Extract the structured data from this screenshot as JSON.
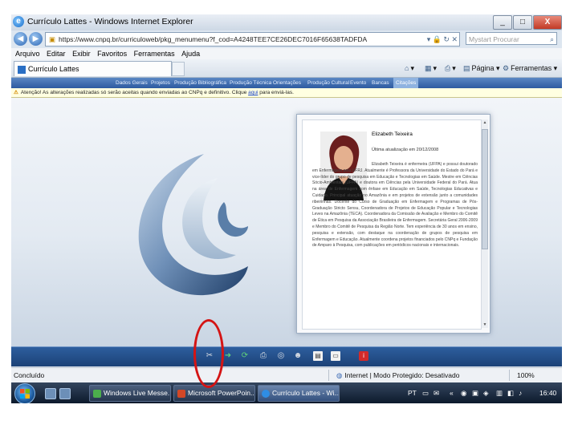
{
  "window": {
    "title": "Currículo Lattes - Windows Internet Explorer",
    "controls": [
      "_",
      "□",
      "X"
    ]
  },
  "address": {
    "url": "https://www.cnpq.br/curriculoweb/pkg_menumenu?f_cod=A4248TEE7CE26DEC7016F65638TADFDA",
    "search_placeholder": "Mystart Procurar"
  },
  "menu": [
    "Arquivo",
    "Editar",
    "Exibir",
    "Favoritos",
    "Ferramentas",
    "Ajuda"
  ],
  "tab": {
    "label": "Currículo Lattes",
    "page_label": "Página",
    "tools_label": "Ferramentas"
  },
  "site_nav": {
    "items": [
      "Dados Gerais",
      "Projetos",
      "Produção Bibliográfica",
      "Produção Técnica",
      "Orientações",
      "Produção Cultural",
      "Evento",
      "Bancas",
      "Citações"
    ],
    "active": "Citações"
  },
  "warning": {
    "text": "Atenção! As alterações realizadas só serão aceitas quando enviadas ao CNPq e definitivo. Clique",
    "link": "aqui",
    "suffix": "para enviá-las."
  },
  "profile": {
    "name": "Elizabeth Teixeira",
    "updated": "Última atualização em 20/12/2008",
    "bio": "Elizabeth Teixeira é enfermeira (UFPA) e possui doutorado em Enfermagem pela UFRJ. Atualmente é Professora da Universidade do Estado do Pará e vice-líder do grupo de pesquisa em Educação e Tecnologias em Saúde. Mestre em Ciências Sócio-Ambientais (UFPA) e doutora em Ciências pela Universidade Federal do Pará. Atua na área de Enfermagem com ênfase em Educação em Saúde, Tecnologias Educativas e Cuidado. Principal atuação no Amazônia e em projetos de extensão junto a comunidades ribeirinhas. Docente do Curso de Graduação em Enfermagem e Programas de Pós-Graduação Stricto Sensu, Coordenadora de Projetos de Educação Popular e Tecnologias Leves na Amazônia (TECA). Coordenadora da Comissão de Avaliação e Membro do Comitê de Ética em Pesquisa da Associação Brasileira de Enfermagem. Secretária Geral 2006-2009 e Membro do Comitê de Pesquisa da Região Norte. Tem experiência de 30 anos em ensino, pesquisa e extensão, com destaque na coordenação de grupos de pesquisa em Enfermagem e Educação. Atualmente coordena projetos financiados pelo CNPq e Fundação de Amparo à Pesquisa, com publicações em periódicos nacionais e internacionais."
  },
  "toolbar_icons": [
    "tools-icon",
    "arrow-icon",
    "refresh-icon",
    "print-icon",
    "web-icon",
    "person-icon",
    "document-icon",
    "window-icon",
    "info-icon"
  ],
  "status": {
    "left": "Concluído",
    "zone": "Internet | Modo Protegido: Desativado",
    "zoom": "100%"
  },
  "taskbar": {
    "buttons": [
      "Windows Live Messe...",
      "Microsoft PowerPoin...",
      "Currículo Lattes - Wi..."
    ],
    "language": "PT",
    "clock": "16:40"
  },
  "colors": {
    "annotation": "#d41414",
    "nav_blue": "#2d5aa0",
    "warning_bg": "#ffffe1"
  }
}
